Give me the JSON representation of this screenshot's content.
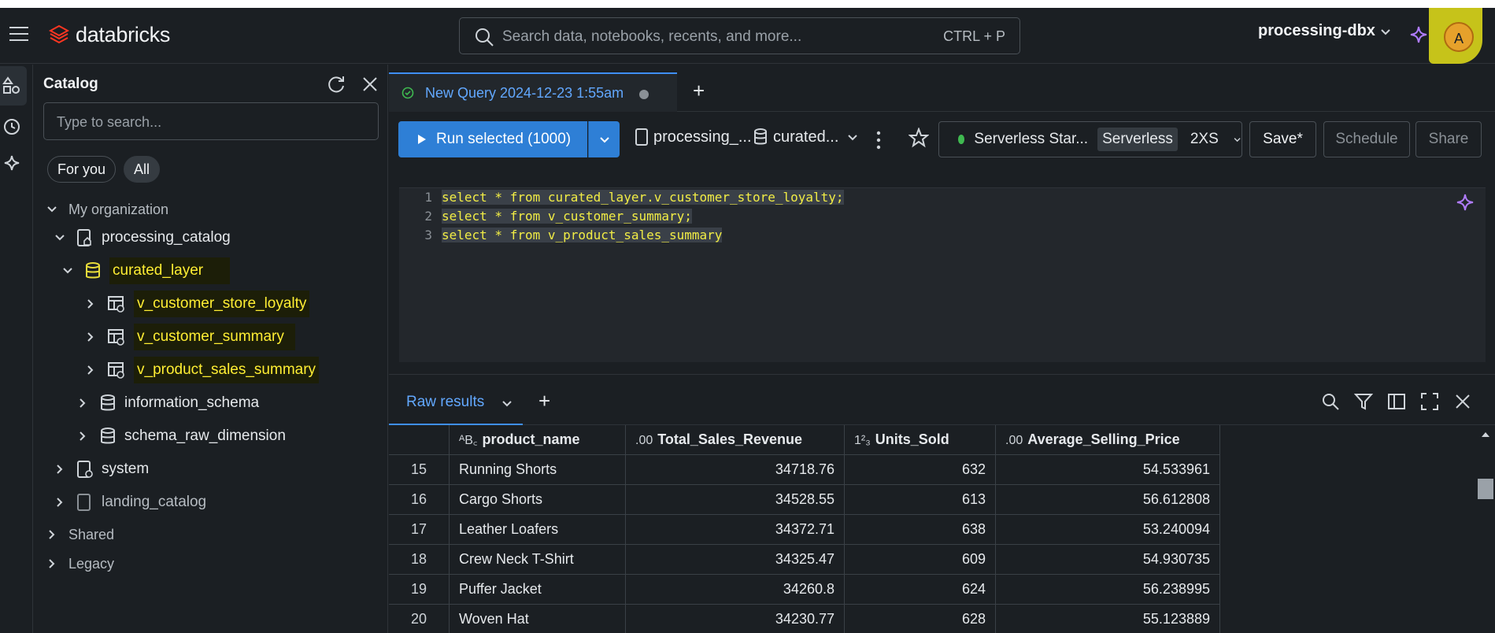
{
  "header": {
    "brand": "databricks",
    "search_placeholder": "Search data, notebooks, recents, and more...",
    "search_shortcut": "CTRL + P",
    "workspace": "processing-dbx",
    "avatar_initial": "A"
  },
  "catalog": {
    "title": "Catalog",
    "search_placeholder": "Type to search...",
    "filters": [
      "For you",
      "All"
    ],
    "tree": {
      "my_org": "My organization",
      "processing_catalog": "processing_catalog",
      "curated_layer": "curated_layer",
      "view1": "v_customer_store_loyalty",
      "view2": "v_customer_summary",
      "view3": "v_product_sales_summary",
      "information_schema": "information_schema",
      "schema_raw_dimension": "schema_raw_dimension",
      "system": "system",
      "landing_catalog": "landing_catalog",
      "shared": "Shared",
      "legacy": "Legacy"
    }
  },
  "query_tab": {
    "label": "New Query 2024-12-23 1:55am"
  },
  "toolbar": {
    "run_label": "Run selected (1000)",
    "catalog_ctx": "processing_...",
    "schema_ctx": "curated...",
    "compute_name": "Serverless Star...",
    "compute_tag": "Serverless",
    "compute_size": "2XS",
    "save": "Save*",
    "schedule": "Schedule",
    "share": "Share"
  },
  "editor": {
    "lines": [
      {
        "n": "1",
        "text": "select * from curated_layer.v_customer_store_loyalty;"
      },
      {
        "n": "2",
        "text": "select * from v_customer_summary;"
      },
      {
        "n": "3",
        "text": "select * from v_product_sales_summary"
      }
    ]
  },
  "results": {
    "tab_label": "Raw results",
    "columns": [
      {
        "type": "ABC",
        "name": "product_name"
      },
      {
        "type": ".00",
        "name": "Total_Sales_Revenue"
      },
      {
        "type": "123",
        "name": "Units_Sold"
      },
      {
        "type": ".00",
        "name": "Average_Selling_Price"
      }
    ],
    "rows": [
      {
        "idx": "15",
        "product": "Running Shorts",
        "revenue": "34718.76",
        "units": "632",
        "price": "54.533961"
      },
      {
        "idx": "16",
        "product": "Cargo Shorts",
        "revenue": "34528.55",
        "units": "613",
        "price": "56.612808"
      },
      {
        "idx": "17",
        "product": "Leather Loafers",
        "revenue": "34372.71",
        "units": "638",
        "price": "53.240094"
      },
      {
        "idx": "18",
        "product": "Crew Neck T-Shirt",
        "revenue": "34325.47",
        "units": "609",
        "price": "54.930735"
      },
      {
        "idx": "19",
        "product": "Puffer Jacket",
        "revenue": "34260.8",
        "units": "624",
        "price": "56.238995"
      },
      {
        "idx": "20",
        "product": "Woven Hat",
        "revenue": "34230.77",
        "units": "628",
        "price": "55.123889"
      }
    ]
  },
  "colors": {
    "accent": "#2e7fd6",
    "highlight": "#ffee33",
    "bg": "#1b1f23"
  }
}
